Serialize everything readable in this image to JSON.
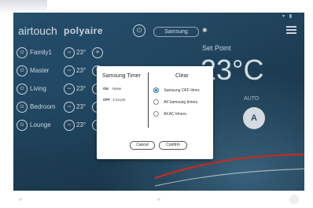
{
  "app": {
    "logo_text": "airtouch",
    "brand_text": "polyaire",
    "unit_name": "Samsung",
    "setpoint_label": "Set Point",
    "setpoint_value": "23°C",
    "mode_label": "AUTO",
    "fan_label": "A"
  },
  "zones": [
    {
      "name": "Family1",
      "temp": "23°"
    },
    {
      "name": "Master",
      "temp": "23°"
    },
    {
      "name": "Living",
      "temp": "23°"
    },
    {
      "name": "Bedroom",
      "temp": "23°"
    },
    {
      "name": "Lounge",
      "temp": "23°"
    }
  ],
  "dialog": {
    "left_title": "Samsung Timer",
    "on_label": "ON",
    "on_value": "None",
    "off_label": "OFF",
    "off_value": "4:14 pm",
    "right_title": "Clear",
    "options": [
      {
        "label": "Samsung OFF timer.",
        "selected": true
      },
      {
        "label": "All Samsung timers.",
        "selected": false
      },
      {
        "label": "All AC timers.",
        "selected": false
      }
    ],
    "cancel_label": "Cancel",
    "confirm_label": "Confirm"
  },
  "colors": {
    "background": "#21455f",
    "accent": "#2e7fa3",
    "dialog_bg": "#ffffff"
  }
}
